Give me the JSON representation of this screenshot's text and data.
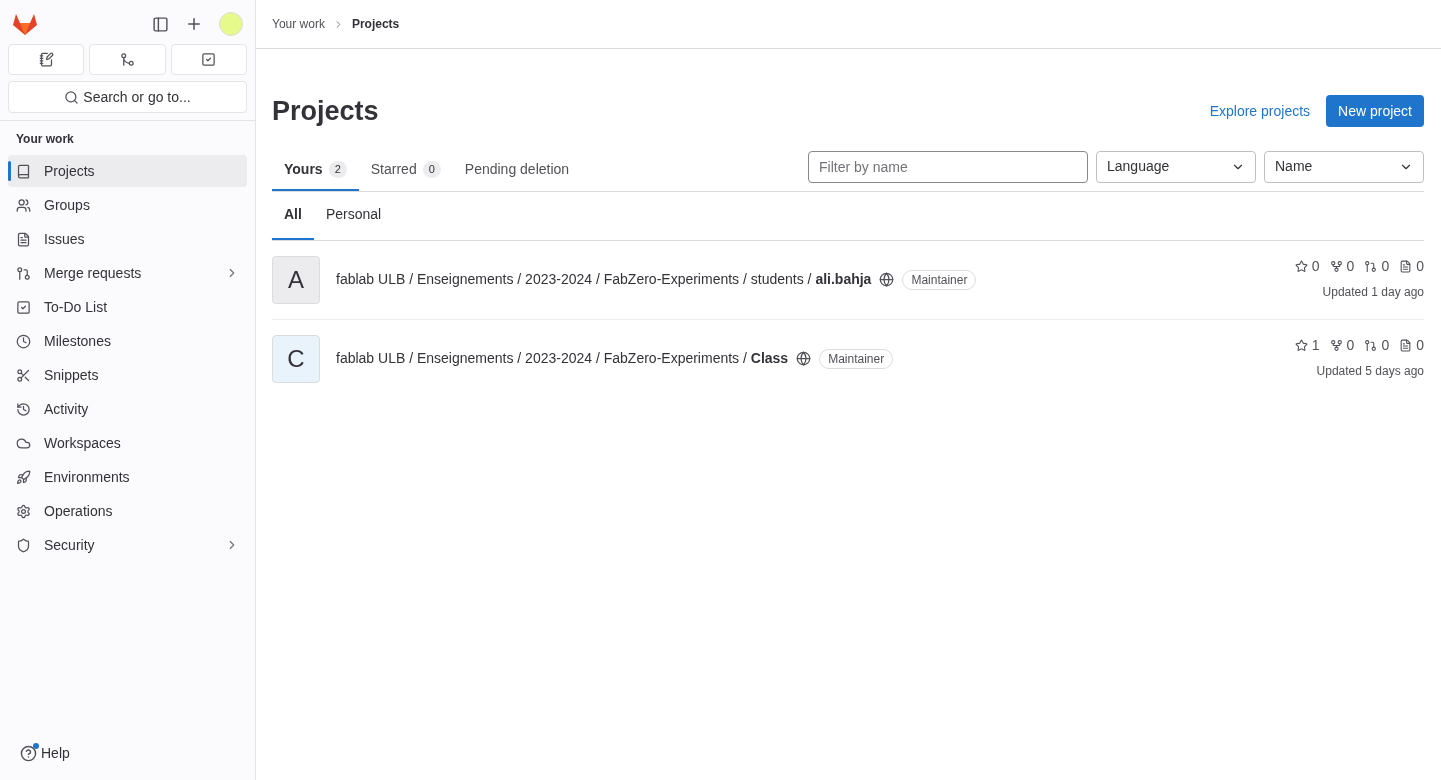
{
  "sidebar": {
    "search_placeholder": "Search or go to...",
    "section_title": "Your work",
    "items": [
      {
        "label": "Projects",
        "selected": true,
        "expandable": false
      },
      {
        "label": "Groups",
        "selected": false,
        "expandable": false
      },
      {
        "label": "Issues",
        "selected": false,
        "expandable": false
      },
      {
        "label": "Merge requests",
        "selected": false,
        "expandable": true
      },
      {
        "label": "To-Do List",
        "selected": false,
        "expandable": false
      },
      {
        "label": "Milestones",
        "selected": false,
        "expandable": false
      },
      {
        "label": "Snippets",
        "selected": false,
        "expandable": false
      },
      {
        "label": "Activity",
        "selected": false,
        "expandable": false
      },
      {
        "label": "Workspaces",
        "selected": false,
        "expandable": false
      },
      {
        "label": "Environments",
        "selected": false,
        "expandable": false
      },
      {
        "label": "Operations",
        "selected": false,
        "expandable": false
      },
      {
        "label": "Security",
        "selected": false,
        "expandable": true
      }
    ],
    "help": {
      "label": "Help",
      "notification": true
    }
  },
  "breadcrumb": [
    "Your work",
    "Projects"
  ],
  "page_title": "Projects",
  "actions": {
    "explore": "Explore projects",
    "new": "New project"
  },
  "tabs": [
    {
      "label": "Yours",
      "count": "2",
      "selected": true
    },
    {
      "label": "Starred",
      "count": "0",
      "selected": false
    },
    {
      "label": "Pending deletion",
      "selected": false
    }
  ],
  "filter": {
    "placeholder": "Filter by name",
    "language": "Language",
    "sort": "Name"
  },
  "subtabs": [
    {
      "label": "All",
      "selected": true
    },
    {
      "label": "Personal",
      "selected": false
    }
  ],
  "projects": [
    {
      "initial": "A",
      "color": "#ececef",
      "path": "fablab ULB / Enseignements / 2023-2024 / FabZero-Experiments / students / **ali.bahja**",
      "role": "Maintainer",
      "stars": "0",
      "forks": "0",
      "merge_requests": "0",
      "issues": "0",
      "updated": "Updated 1 day ago"
    },
    {
      "initial": "C",
      "color": "#e9f3fc",
      "path": "fablab ULB / Enseignements / 2023-2024 / FabZero-Experiments / **Class**",
      "role": "Maintainer",
      "stars": "1",
      "forks": "0",
      "merge_requests": "0",
      "issues": "0",
      "updated": "Updated 5 days ago"
    }
  ]
}
